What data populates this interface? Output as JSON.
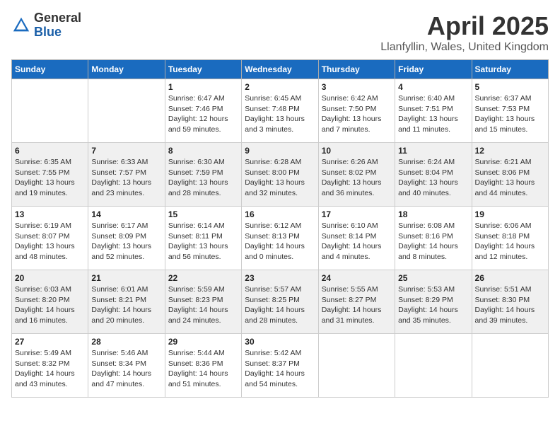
{
  "logo": {
    "general": "General",
    "blue": "Blue"
  },
  "title": "April 2025",
  "location": "Llanfyllin, Wales, United Kingdom",
  "days_of_week": [
    "Sunday",
    "Monday",
    "Tuesday",
    "Wednesday",
    "Thursday",
    "Friday",
    "Saturday"
  ],
  "weeks": [
    [
      {
        "day": "",
        "sunrise": "",
        "sunset": "",
        "daylight": ""
      },
      {
        "day": "",
        "sunrise": "",
        "sunset": "",
        "daylight": ""
      },
      {
        "day": "1",
        "sunrise": "Sunrise: 6:47 AM",
        "sunset": "Sunset: 7:46 PM",
        "daylight": "Daylight: 12 hours and 59 minutes."
      },
      {
        "day": "2",
        "sunrise": "Sunrise: 6:45 AM",
        "sunset": "Sunset: 7:48 PM",
        "daylight": "Daylight: 13 hours and 3 minutes."
      },
      {
        "day": "3",
        "sunrise": "Sunrise: 6:42 AM",
        "sunset": "Sunset: 7:50 PM",
        "daylight": "Daylight: 13 hours and 7 minutes."
      },
      {
        "day": "4",
        "sunrise": "Sunrise: 6:40 AM",
        "sunset": "Sunset: 7:51 PM",
        "daylight": "Daylight: 13 hours and 11 minutes."
      },
      {
        "day": "5",
        "sunrise": "Sunrise: 6:37 AM",
        "sunset": "Sunset: 7:53 PM",
        "daylight": "Daylight: 13 hours and 15 minutes."
      }
    ],
    [
      {
        "day": "6",
        "sunrise": "Sunrise: 6:35 AM",
        "sunset": "Sunset: 7:55 PM",
        "daylight": "Daylight: 13 hours and 19 minutes."
      },
      {
        "day": "7",
        "sunrise": "Sunrise: 6:33 AM",
        "sunset": "Sunset: 7:57 PM",
        "daylight": "Daylight: 13 hours and 23 minutes."
      },
      {
        "day": "8",
        "sunrise": "Sunrise: 6:30 AM",
        "sunset": "Sunset: 7:59 PM",
        "daylight": "Daylight: 13 hours and 28 minutes."
      },
      {
        "day": "9",
        "sunrise": "Sunrise: 6:28 AM",
        "sunset": "Sunset: 8:00 PM",
        "daylight": "Daylight: 13 hours and 32 minutes."
      },
      {
        "day": "10",
        "sunrise": "Sunrise: 6:26 AM",
        "sunset": "Sunset: 8:02 PM",
        "daylight": "Daylight: 13 hours and 36 minutes."
      },
      {
        "day": "11",
        "sunrise": "Sunrise: 6:24 AM",
        "sunset": "Sunset: 8:04 PM",
        "daylight": "Daylight: 13 hours and 40 minutes."
      },
      {
        "day": "12",
        "sunrise": "Sunrise: 6:21 AM",
        "sunset": "Sunset: 8:06 PM",
        "daylight": "Daylight: 13 hours and 44 minutes."
      }
    ],
    [
      {
        "day": "13",
        "sunrise": "Sunrise: 6:19 AM",
        "sunset": "Sunset: 8:07 PM",
        "daylight": "Daylight: 13 hours and 48 minutes."
      },
      {
        "day": "14",
        "sunrise": "Sunrise: 6:17 AM",
        "sunset": "Sunset: 8:09 PM",
        "daylight": "Daylight: 13 hours and 52 minutes."
      },
      {
        "day": "15",
        "sunrise": "Sunrise: 6:14 AM",
        "sunset": "Sunset: 8:11 PM",
        "daylight": "Daylight: 13 hours and 56 minutes."
      },
      {
        "day": "16",
        "sunrise": "Sunrise: 6:12 AM",
        "sunset": "Sunset: 8:13 PM",
        "daylight": "Daylight: 14 hours and 0 minutes."
      },
      {
        "day": "17",
        "sunrise": "Sunrise: 6:10 AM",
        "sunset": "Sunset: 8:14 PM",
        "daylight": "Daylight: 14 hours and 4 minutes."
      },
      {
        "day": "18",
        "sunrise": "Sunrise: 6:08 AM",
        "sunset": "Sunset: 8:16 PM",
        "daylight": "Daylight: 14 hours and 8 minutes."
      },
      {
        "day": "19",
        "sunrise": "Sunrise: 6:06 AM",
        "sunset": "Sunset: 8:18 PM",
        "daylight": "Daylight: 14 hours and 12 minutes."
      }
    ],
    [
      {
        "day": "20",
        "sunrise": "Sunrise: 6:03 AM",
        "sunset": "Sunset: 8:20 PM",
        "daylight": "Daylight: 14 hours and 16 minutes."
      },
      {
        "day": "21",
        "sunrise": "Sunrise: 6:01 AM",
        "sunset": "Sunset: 8:21 PM",
        "daylight": "Daylight: 14 hours and 20 minutes."
      },
      {
        "day": "22",
        "sunrise": "Sunrise: 5:59 AM",
        "sunset": "Sunset: 8:23 PM",
        "daylight": "Daylight: 14 hours and 24 minutes."
      },
      {
        "day": "23",
        "sunrise": "Sunrise: 5:57 AM",
        "sunset": "Sunset: 8:25 PM",
        "daylight": "Daylight: 14 hours and 28 minutes."
      },
      {
        "day": "24",
        "sunrise": "Sunrise: 5:55 AM",
        "sunset": "Sunset: 8:27 PM",
        "daylight": "Daylight: 14 hours and 31 minutes."
      },
      {
        "day": "25",
        "sunrise": "Sunrise: 5:53 AM",
        "sunset": "Sunset: 8:29 PM",
        "daylight": "Daylight: 14 hours and 35 minutes."
      },
      {
        "day": "26",
        "sunrise": "Sunrise: 5:51 AM",
        "sunset": "Sunset: 8:30 PM",
        "daylight": "Daylight: 14 hours and 39 minutes."
      }
    ],
    [
      {
        "day": "27",
        "sunrise": "Sunrise: 5:49 AM",
        "sunset": "Sunset: 8:32 PM",
        "daylight": "Daylight: 14 hours and 43 minutes."
      },
      {
        "day": "28",
        "sunrise": "Sunrise: 5:46 AM",
        "sunset": "Sunset: 8:34 PM",
        "daylight": "Daylight: 14 hours and 47 minutes."
      },
      {
        "day": "29",
        "sunrise": "Sunrise: 5:44 AM",
        "sunset": "Sunset: 8:36 PM",
        "daylight": "Daylight: 14 hours and 51 minutes."
      },
      {
        "day": "30",
        "sunrise": "Sunrise: 5:42 AM",
        "sunset": "Sunset: 8:37 PM",
        "daylight": "Daylight: 14 hours and 54 minutes."
      },
      {
        "day": "",
        "sunrise": "",
        "sunset": "",
        "daylight": ""
      },
      {
        "day": "",
        "sunrise": "",
        "sunset": "",
        "daylight": ""
      },
      {
        "day": "",
        "sunrise": "",
        "sunset": "",
        "daylight": ""
      }
    ]
  ]
}
